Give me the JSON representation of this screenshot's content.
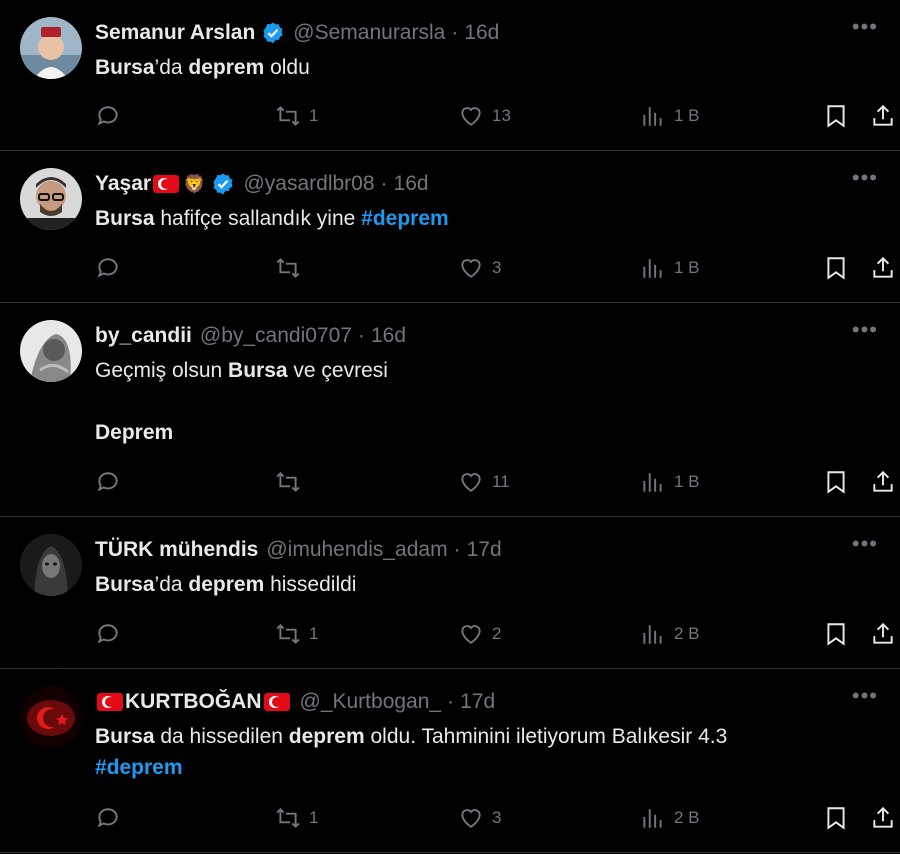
{
  "tweets": [
    {
      "name": "Semanur Arslan",
      "handle": "@Semanurarsla",
      "time": "16d",
      "text_parts": [
        {
          "b": "Bursa"
        },
        {
          "t": "’da "
        },
        {
          "b": "deprem"
        },
        {
          "t": " oldu"
        }
      ],
      "replies": "",
      "retweets": "1",
      "likes": "13",
      "views": "1 B"
    },
    {
      "name": "Yaşar",
      "handle": "@yasardlbr08",
      "time": "16d",
      "text_parts": [
        {
          "b": "Bursa"
        },
        {
          "t": " hafifçe sallandık yine "
        },
        {
          "tag": "#deprem"
        }
      ],
      "replies": "",
      "retweets": "",
      "likes": "3",
      "views": "1 B"
    },
    {
      "name": "by_candii",
      "handle": "@by_candi0707",
      "time": "16d",
      "text_parts": [
        {
          "t": "Geçmiş olsun "
        },
        {
          "b": "Bursa"
        },
        {
          "t": " ve çevresi\n\n"
        },
        {
          "b": "Deprem"
        }
      ],
      "replies": "",
      "retweets": "",
      "likes": "11",
      "views": "1 B"
    },
    {
      "name": "TÜRK mühendis",
      "handle": "@imuhendis_adam",
      "time": "17d",
      "text_parts": [
        {
          "b": "Bursa"
        },
        {
          "t": "’da "
        },
        {
          "b": "deprem"
        },
        {
          "t": " hissedildi"
        }
      ],
      "replies": "",
      "retweets": "1",
      "likes": "2",
      "views": "2 B"
    },
    {
      "name": "KURTBOĞAN",
      "handle": "@_Kurtbogan_",
      "time": "17d",
      "text_parts": [
        {
          "b": "Bursa"
        },
        {
          "t": " da hissedilen "
        },
        {
          "b": "deprem"
        },
        {
          "t": " oldu. Tahminini iletiyorum Balıkesir 4.3\n"
        },
        {
          "tag": "#deprem"
        }
      ],
      "replies": "",
      "retweets": "1",
      "likes": "3",
      "views": "2 B"
    }
  ],
  "colors": {
    "background": "#000000",
    "text": "#e7e9ea",
    "muted": "#71767b",
    "link": "#1d9bf0",
    "verified": "#1d9bf0",
    "divider": "#2f3336"
  },
  "icons": [
    "reply-icon",
    "retweet-icon",
    "like-icon",
    "views-icon",
    "bookmark-icon",
    "share-icon",
    "more-icon",
    "verified-icon"
  ]
}
